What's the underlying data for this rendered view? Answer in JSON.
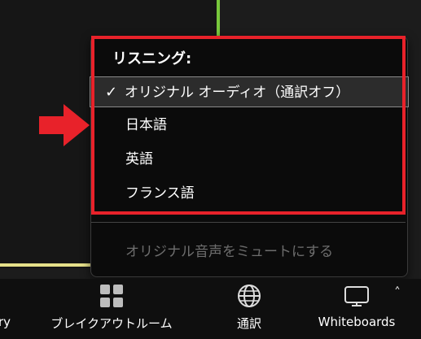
{
  "menu": {
    "title": "リスニング:",
    "items": [
      {
        "label": "オリジナル オーディオ（通訳オフ）",
        "checked": true
      },
      {
        "label": "日本語",
        "checked": false
      },
      {
        "label": "英語",
        "checked": false
      },
      {
        "label": "フランス語",
        "checked": false
      }
    ],
    "mute_original_label": "オリジナル音声をミュートにする",
    "checkmark": "✓"
  },
  "toolbar": {
    "cut_label": "ry",
    "breakout_label": "ブレイクアウトルーム",
    "interpretation_label": "通訳",
    "whiteboards_label": "Whiteboards",
    "more_chevron": "˄"
  },
  "colors": {
    "highlight": "#e8222a",
    "speaker_green": "#78c83c",
    "tile_border_yellow": "#e6e08a"
  },
  "icons": [
    "breakout-rooms-icon",
    "globe-icon",
    "whiteboard-icon",
    "chevron-up-icon",
    "checkmark-icon",
    "red-arrow-icon"
  ]
}
